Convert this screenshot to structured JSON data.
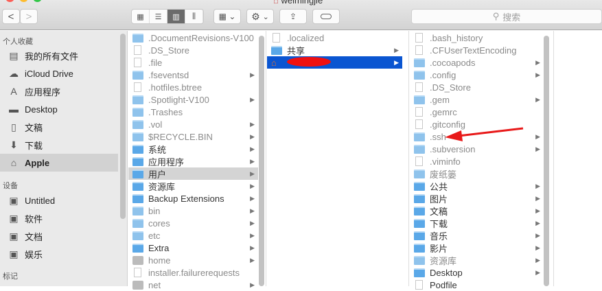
{
  "window": {
    "title": "weimingjie"
  },
  "toolbar": {
    "back": "<",
    "forward": ">",
    "view_icons": [
      "icon-view",
      "list-view",
      "column-view",
      "coverflow-view"
    ],
    "search_placeholder": "搜索"
  },
  "sidebar": {
    "favorites_header": "个人收藏",
    "favorites": [
      {
        "label": "我的所有文件",
        "icon": "all-files-icon"
      },
      {
        "label": "iCloud Drive",
        "icon": "cloud-icon"
      },
      {
        "label": "应用程序",
        "icon": "applications-icon"
      },
      {
        "label": "Desktop",
        "icon": "desktop-icon"
      },
      {
        "label": "文稿",
        "icon": "documents-icon"
      },
      {
        "label": "下载",
        "icon": "downloads-icon"
      },
      {
        "label": "Apple",
        "icon": "home-icon",
        "selected": true
      }
    ],
    "devices_header": "设备",
    "devices": [
      {
        "label": "Untitled"
      },
      {
        "label": "软件"
      },
      {
        "label": "文档"
      },
      {
        "label": "娱乐"
      }
    ],
    "tags_header": "标记"
  },
  "columns": [
    [
      {
        "n": ".DocumentRevisions-V100",
        "t": "folder",
        "d": 1
      },
      {
        "n": ".DS_Store",
        "t": "doc",
        "d": 1
      },
      {
        "n": ".file",
        "t": "doc",
        "d": 1
      },
      {
        "n": ".fseventsd",
        "t": "folder",
        "d": 1,
        "a": 1
      },
      {
        "n": ".hotfiles.btree",
        "t": "doc",
        "d": 1
      },
      {
        "n": ".Spotlight-V100",
        "t": "folder",
        "d": 1,
        "a": 1
      },
      {
        "n": ".Trashes",
        "t": "folder",
        "d": 1
      },
      {
        "n": ".vol",
        "t": "folder",
        "d": 1,
        "a": 1
      },
      {
        "n": "$RECYCLE.BIN",
        "t": "folder",
        "d": 1,
        "a": 1
      },
      {
        "n": "系统",
        "t": "folder",
        "a": 1
      },
      {
        "n": "应用程序",
        "t": "folder",
        "a": 1
      },
      {
        "n": "用户",
        "t": "folder",
        "a": 1,
        "s": "grey"
      },
      {
        "n": "资源库",
        "t": "folder",
        "a": 1
      },
      {
        "n": "Backup Extensions",
        "t": "folder",
        "a": 1
      },
      {
        "n": "bin",
        "t": "folder",
        "d": 1,
        "a": 1
      },
      {
        "n": "cores",
        "t": "folder",
        "d": 1,
        "a": 1
      },
      {
        "n": "etc",
        "t": "folder",
        "d": 1,
        "a": 1
      },
      {
        "n": "Extra",
        "t": "folder",
        "a": 1
      },
      {
        "n": "home",
        "t": "drive",
        "d": 1,
        "a": 1
      },
      {
        "n": "installer.failurerequests",
        "t": "doc",
        "d": 1
      },
      {
        "n": "net",
        "t": "drive",
        "d": 1,
        "a": 1
      }
    ],
    [
      {
        "n": ".localized",
        "t": "doc",
        "d": 1
      },
      {
        "n": "共享",
        "t": "folder",
        "a": 1
      },
      {
        "n": "",
        "t": "home",
        "a": 1,
        "s": "blue"
      }
    ],
    [
      {
        "n": ".bash_history",
        "t": "doc",
        "d": 1
      },
      {
        "n": ".CFUserTextEncoding",
        "t": "doc",
        "d": 1
      },
      {
        "n": ".cocoapods",
        "t": "folder",
        "d": 1,
        "a": 1
      },
      {
        "n": ".config",
        "t": "folder",
        "d": 1,
        "a": 1
      },
      {
        "n": ".DS_Store",
        "t": "doc",
        "d": 1
      },
      {
        "n": ".gem",
        "t": "folder",
        "d": 1,
        "a": 1
      },
      {
        "n": ".gemrc",
        "t": "doc",
        "d": 1
      },
      {
        "n": ".gitconfig",
        "t": "doc",
        "d": 1
      },
      {
        "n": ".ssh",
        "t": "folder",
        "d": 1,
        "a": 1
      },
      {
        "n": ".subversion",
        "t": "folder",
        "d": 1,
        "a": 1
      },
      {
        "n": ".viminfo",
        "t": "doc",
        "d": 1
      },
      {
        "n": "废纸篓",
        "t": "folder",
        "d": 1
      },
      {
        "n": "公共",
        "t": "folder",
        "a": 1
      },
      {
        "n": "图片",
        "t": "folder",
        "a": 1
      },
      {
        "n": "文稿",
        "t": "folder",
        "a": 1
      },
      {
        "n": "下载",
        "t": "folder",
        "a": 1
      },
      {
        "n": "音乐",
        "t": "folder",
        "a": 1
      },
      {
        "n": "影片",
        "t": "folder",
        "a": 1
      },
      {
        "n": "资源库",
        "t": "folder",
        "d": 1,
        "a": 1
      },
      {
        "n": "Desktop",
        "t": "folder",
        "a": 1
      },
      {
        "n": "Podfile",
        "t": "doc"
      }
    ]
  ],
  "annotation_color": "#e81a1a"
}
